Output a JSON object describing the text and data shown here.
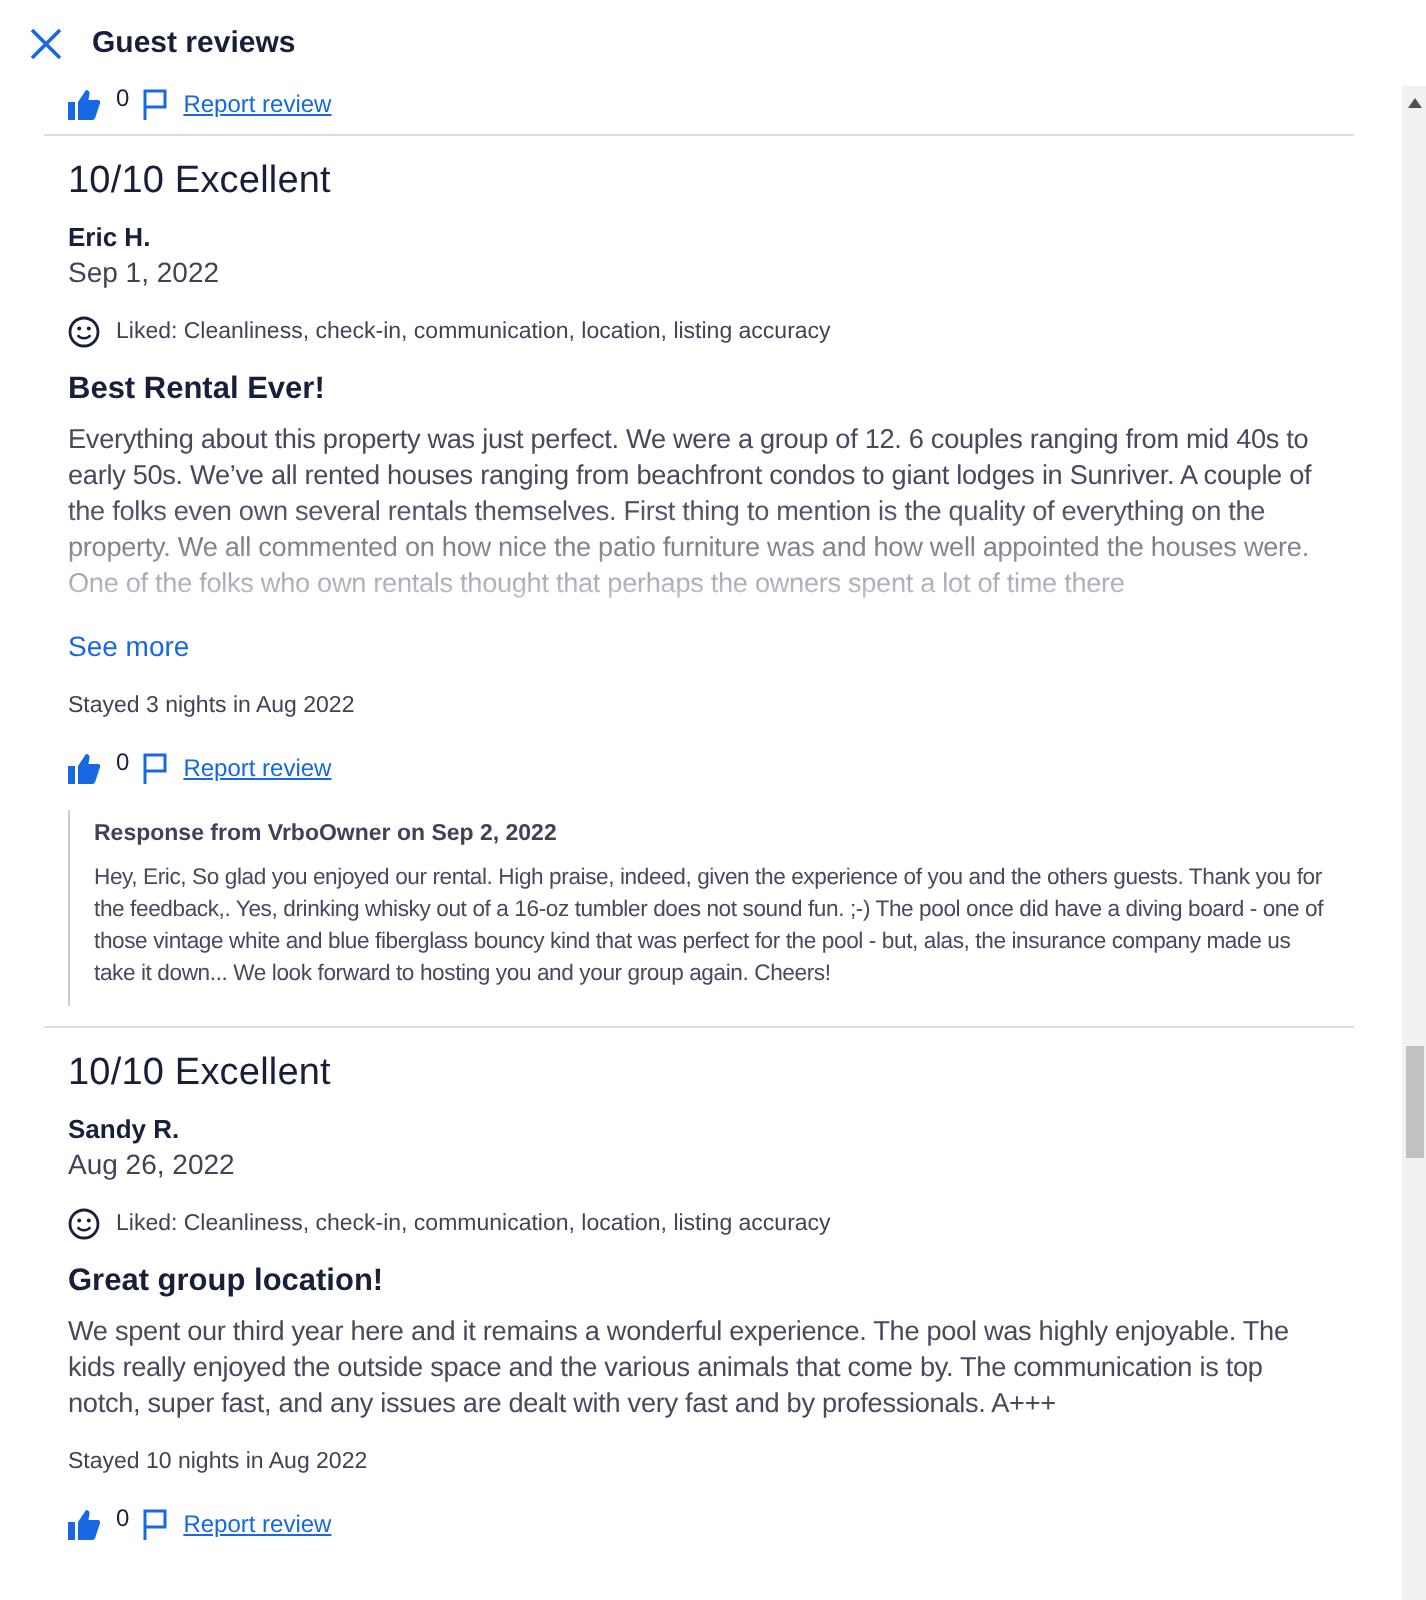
{
  "header": {
    "title": "Guest reviews"
  },
  "previous_review_actions": {
    "helpful_count": "0",
    "report_link": "Report review"
  },
  "reviews": [
    {
      "rating": "10/10 Excellent",
      "author": "Eric H.",
      "date": "Sep 1, 2022",
      "liked": "Liked: Cleanliness, check-in, communication, location, listing accuracy",
      "headline": "Best Rental Ever!",
      "body": "Everything about this property was just perfect. We were a group of 12. 6 couples ranging from mid 40s to early 50s. We’ve all rented houses ranging from beachfront condos to giant lodges in Sunriver. A couple of the folks even own several rentals themselves. First thing to mention is the quality of everything on the property. We all commented on how nice the patio furniture was and how well appointed the houses were. One of the folks who own rentals thought that perhaps the owners spent a lot of time there",
      "collapsed": true,
      "see_more": "See more",
      "stay": "Stayed 3 nights in Aug 2022",
      "helpful_count": "0",
      "report_link": "Report review",
      "response": {
        "title": "Response from VrboOwner on Sep 2, 2022",
        "text": "Hey, Eric, So glad you enjoyed our rental. High praise, indeed, given the experience of you and the others guests. Thank you for the feedback,. Yes, drinking whisky out of a 16-oz tumbler does not sound fun. ;-) The pool once did have a diving board - one of those vintage white and blue fiberglass bouncy kind that was perfect for the pool - but, alas, the insurance company made us take it down... We look forward to hosting you and your group again. Cheers!"
      }
    },
    {
      "rating": "10/10 Excellent",
      "author": "Sandy R.",
      "date": "Aug 26, 2022",
      "liked": "Liked: Cleanliness, check-in, communication, location, listing accuracy",
      "headline": "Great group location!",
      "body": "We spent our third year here and it remains a wonderful experience. The pool was highly enjoyable. The kids really enjoyed the outside space and the various animals that come by. The communication is top notch, super fast, and any issues are dealt with very fast and by professionals. A+++",
      "collapsed": false,
      "stay": "Stayed 10 nights in Aug 2022",
      "helpful_count": "0",
      "report_link": "Report review"
    }
  ]
}
